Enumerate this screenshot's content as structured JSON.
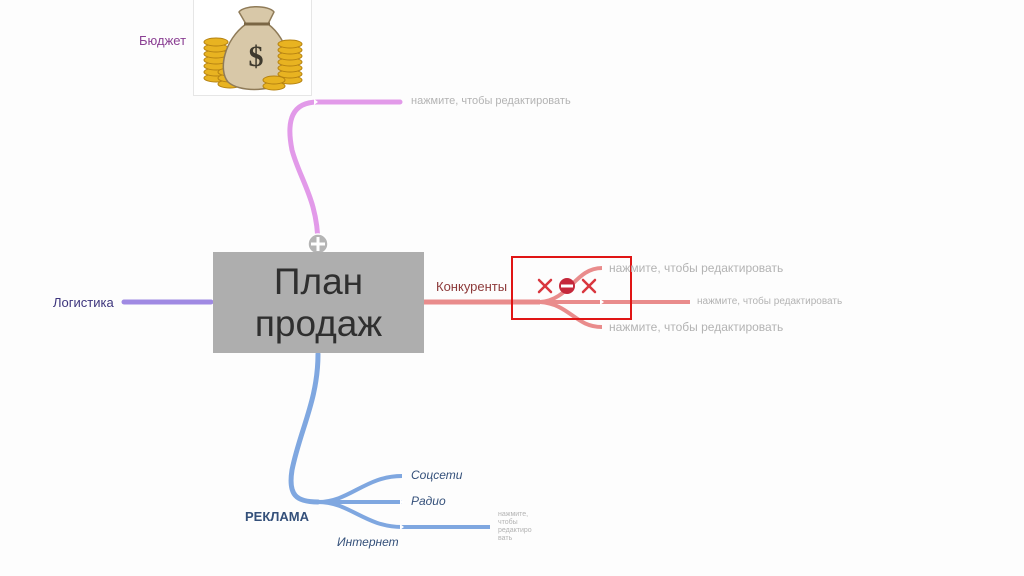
{
  "central_topic": {
    "line1": "План",
    "line2": "продаж"
  },
  "placeholder_text": "нажмите, чтобы редактировать",
  "budget": {
    "label": "Бюджет",
    "image": "money-bag-with-coins"
  },
  "logistics": {
    "label": "Логистика"
  },
  "competitors": {
    "label": "Конкуренты",
    "placeholder": "нажмите, чтобы редактировать",
    "children": [
      "нажмите, чтобы редактировать",
      "нажмите, чтобы редактировать",
      "нажмите, чтобы редактировать"
    ],
    "icons": [
      "close-icon",
      "no-entry-icon",
      "close-icon"
    ]
  },
  "advertising": {
    "label": "РЕКЛАМА",
    "children": [
      "Соцсети",
      "Радио",
      "Интернет"
    ],
    "internet_child_lines": [
      "нажмите,",
      "чтобы",
      "редактиро",
      "вать"
    ]
  },
  "colors": {
    "budget_branch": "#e29ae9",
    "logistics_branch": "#a08ae3",
    "competitors_branch": "#e98c8c",
    "advertising_branch": "#7fa7e0",
    "central_fill": "#aeaeae",
    "selection": "#e01515"
  }
}
